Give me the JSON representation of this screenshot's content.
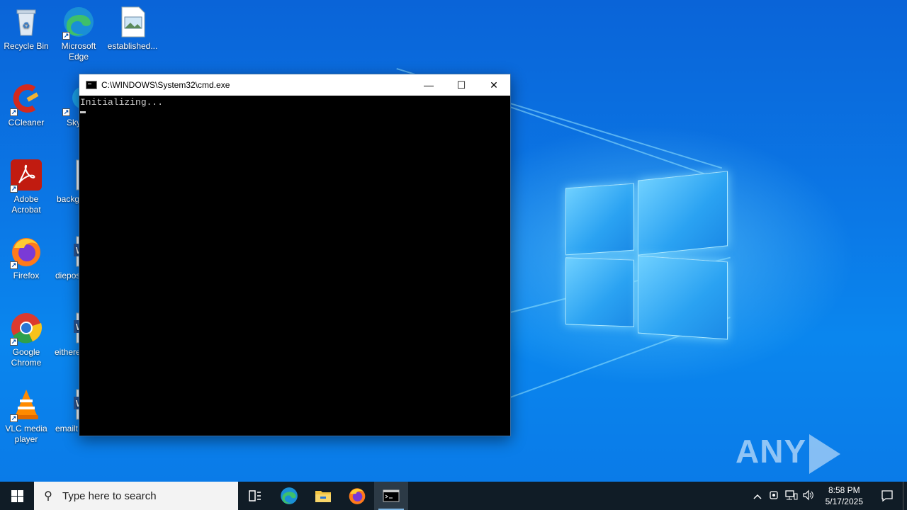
{
  "desktop": {
    "icons": [
      {
        "label": "Recycle Bin",
        "icon": "recycle-bin-icon"
      },
      {
        "label": "Microsoft Edge",
        "icon": "edge-icon"
      },
      {
        "label": "established...",
        "icon": "image-file-icon"
      },
      {
        "label": "CCleaner",
        "icon": "ccleaner-icon"
      },
      {
        "label": "Sky",
        "icon": "skype-icon"
      },
      {
        "label": "Adobe Acrobat",
        "icon": "acrobat-icon"
      },
      {
        "label": "backg",
        "icon": "image-file-icon"
      },
      {
        "label": "Firefox",
        "icon": "firefox-icon"
      },
      {
        "label": "diepos",
        "icon": "word-doc-icon"
      },
      {
        "label": "Google Chrome",
        "icon": "chrome-icon"
      },
      {
        "label": "eithere",
        "icon": "word-doc-icon"
      },
      {
        "label": "VLC media player",
        "icon": "vlc-icon"
      },
      {
        "label": "emailt",
        "icon": "word-doc-icon"
      }
    ]
  },
  "cmd_window": {
    "title": "C:\\WINDOWS\\System32\\cmd.exe",
    "output": "Initializing...",
    "minimize_glyph": "—",
    "maximize_glyph": "☐",
    "close_glyph": "✕"
  },
  "watermark": {
    "left": "ANY",
    "right": "RUN"
  },
  "taskbar": {
    "search_placeholder": "Type here to search",
    "pinned": [
      "task-view-icon",
      "edge-icon",
      "file-explorer-icon",
      "firefox-icon",
      "cmd-icon"
    ],
    "tray": {
      "chevron": "^",
      "time": "8:58 PM",
      "date": "5/17/2025"
    }
  },
  "colors": {
    "taskbar": "#101c26",
    "desktop": "#0a78e6",
    "console_bg": "#000000",
    "console_text": "#cccccc"
  }
}
